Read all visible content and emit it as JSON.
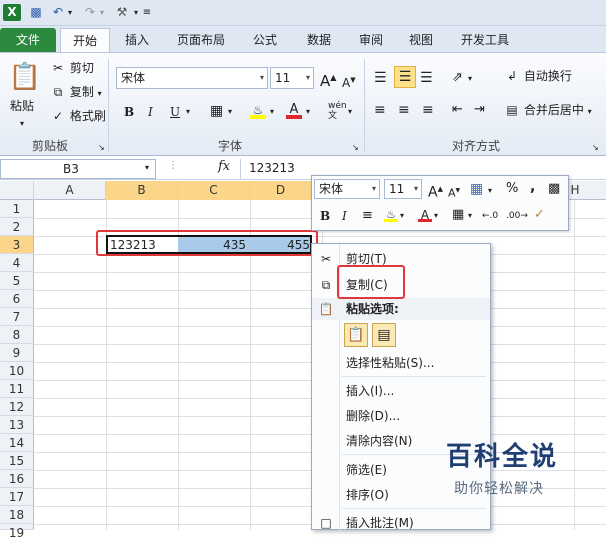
{
  "qat": {
    "excel_icon": "excel-icon",
    "save_icon": "save-icon",
    "undo_icon": "undo-icon",
    "redo_icon": "redo-icon",
    "tool_icon": "tool-icon"
  },
  "tabs": [
    "文件",
    "开始",
    "插入",
    "页面布局",
    "公式",
    "数据",
    "审阅",
    "视图",
    "开发工具"
  ],
  "ribbon": {
    "clipboard": {
      "paste": "粘贴",
      "cut": "剪切",
      "copy": "复制",
      "format_painter": "格式刷",
      "label": "剪贴板"
    },
    "font": {
      "name": "宋体",
      "size": "11",
      "label": "字体",
      "bold": "B",
      "italic": "I",
      "underline": "U",
      "grow": "A",
      "shrink": "A"
    },
    "alignment": {
      "wrap": "自动换行",
      "merge": "合并后居中",
      "label": "对齐方式"
    }
  },
  "formula_bar": {
    "namebox": "B3",
    "fx": "fx",
    "value": "123213"
  },
  "columns": [
    "A",
    "B",
    "C",
    "D",
    "H"
  ],
  "rows": [
    "1",
    "2",
    "3",
    "4",
    "5",
    "6",
    "7",
    "8",
    "9",
    "10",
    "11",
    "12",
    "13",
    "14",
    "15",
    "16",
    "17",
    "18",
    "19"
  ],
  "cells": {
    "b3": "123213",
    "c3": "435",
    "d3": "455"
  },
  "mini_toolbar": {
    "font": "宋体",
    "size": "11",
    "grow": "A",
    "shrink": "A",
    "percent": "%",
    "comma": ",",
    "bold": "B",
    "italic": "I",
    "color_a": "A"
  },
  "context_menu": {
    "cut": "剪切(T)",
    "copy": "复制(C)",
    "paste_options": "粘贴选项:",
    "paste_special": "选择性粘贴(S)...",
    "insert": "插入(I)...",
    "delete": "删除(D)...",
    "clear": "清除内容(N)",
    "filter": "筛选(E)",
    "sort": "排序(O)",
    "insert_comment": "插入批注(M)"
  },
  "watermark": {
    "title": "百科全说",
    "subtitle": "助你轻松解决"
  },
  "colors": {
    "file_tab": "#2b8a3e",
    "selection": "#a9cbe9",
    "highlight": "#e0383a",
    "header_sel": "#fbd68a"
  }
}
